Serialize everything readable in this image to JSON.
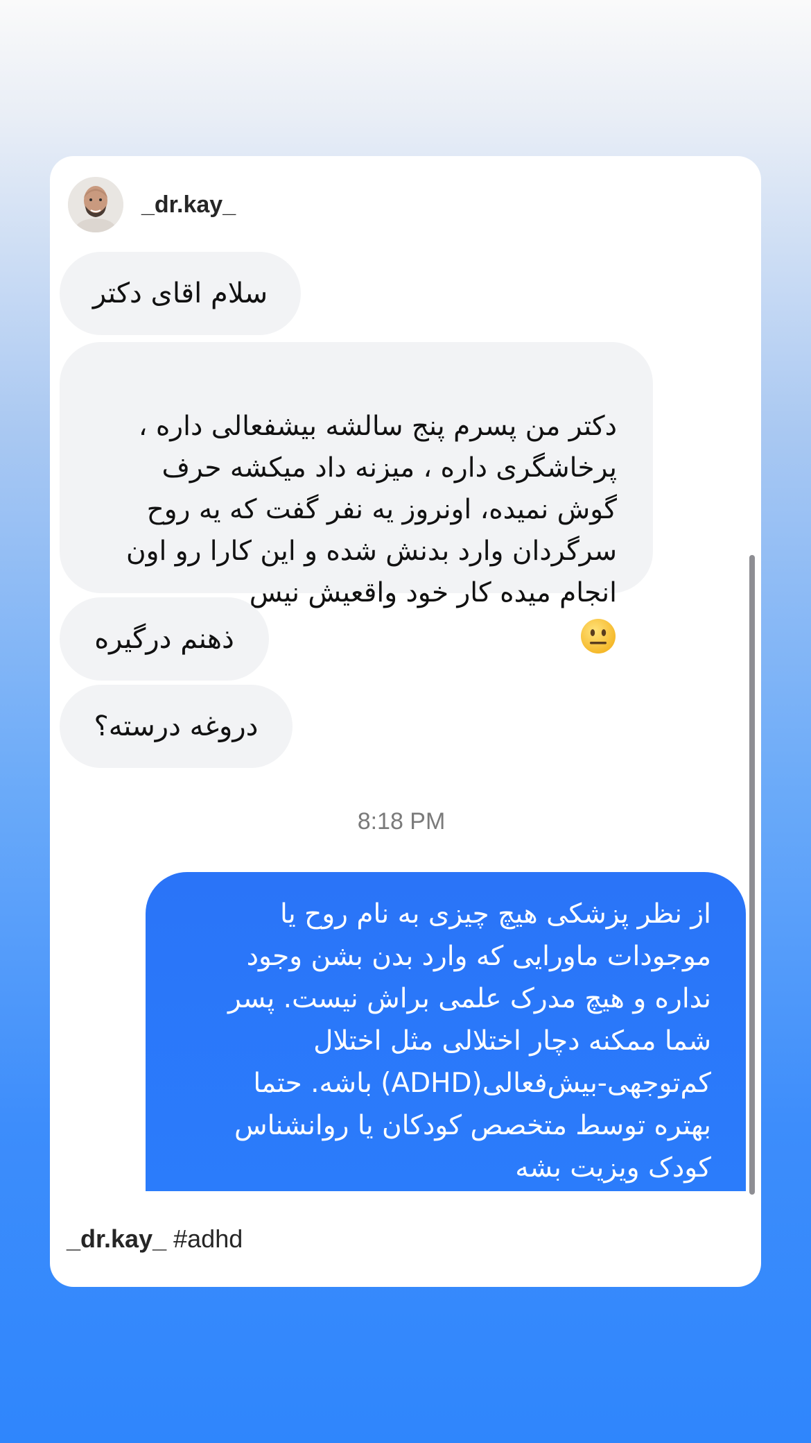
{
  "header": {
    "username": "_dr.kay_",
    "avatar_icon": "avatar-photo"
  },
  "messages": {
    "incoming": [
      "سلام اقای دکتر",
      "دکتر من پسرم پنج سالشه بیشفعالی داره ،\nپرخاشگری داره ، میزنه داد میکشه حرف\nگوش نمیده، اونروز یه نفر گفت که یه روح\nسرگردان وارد بدنش شده و این کارا رو اون\nانجام میده کار خود واقعیش نیس",
      "ذهنم درگیره",
      "دروغه درسته؟"
    ],
    "emoji_icon": "neutral-face-emoji",
    "timestamp": "8:18 PM",
    "outgoing": "از نظر پزشکی هیچ چیزی به نام روح یا\nموجودات ماورایی که وارد بدن بشن وجود\nنداره و هیچ مدرک علمی براش نیست. پسر\nشما ممکنه دچار اختلالی مثل اختلال\nکم‌توجهی-بیش‌فعالی(ADHD) باشه. حتما\nبهتره توسط متخصص کودکان یا روانشناس\nکودک ویزیت بشه"
  },
  "caption": {
    "username": "_dr.kay_",
    "hashtag": "#adhd"
  },
  "colors": {
    "incoming_bubble": "#f2f3f5",
    "outgoing_bubble": "#2b7cfb",
    "background_bottom": "#2f86fc"
  }
}
